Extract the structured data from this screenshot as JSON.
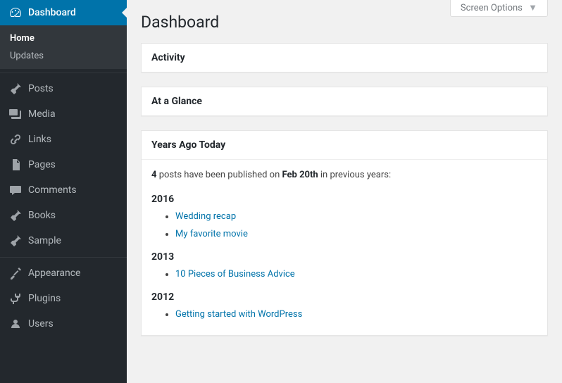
{
  "page_title": "Dashboard",
  "screen_options_label": "Screen Options",
  "sidebar": {
    "dashboard": {
      "label": "Dashboard",
      "submenu": {
        "home": "Home",
        "updates": "Updates"
      }
    },
    "posts": "Posts",
    "media": "Media",
    "links": "Links",
    "pages": "Pages",
    "comments": "Comments",
    "books": "Books",
    "sample": "Sample",
    "appearance": "Appearance",
    "plugins": "Plugins",
    "users": "Users"
  },
  "widgets": {
    "activity": {
      "title": "Activity"
    },
    "glance": {
      "title": "At a Glance"
    },
    "years_ago": {
      "title": "Years Ago Today",
      "post_count": "4",
      "intro_mid": " posts have been published on ",
      "date": "Feb 20th",
      "intro_end": " in previous years:",
      "groups": [
        {
          "year": "2016",
          "posts": [
            "Wedding recap",
            "My favorite movie"
          ]
        },
        {
          "year": "2013",
          "posts": [
            "10 Pieces of Business Advice"
          ]
        },
        {
          "year": "2012",
          "posts": [
            "Getting started with WordPress"
          ]
        }
      ]
    }
  }
}
